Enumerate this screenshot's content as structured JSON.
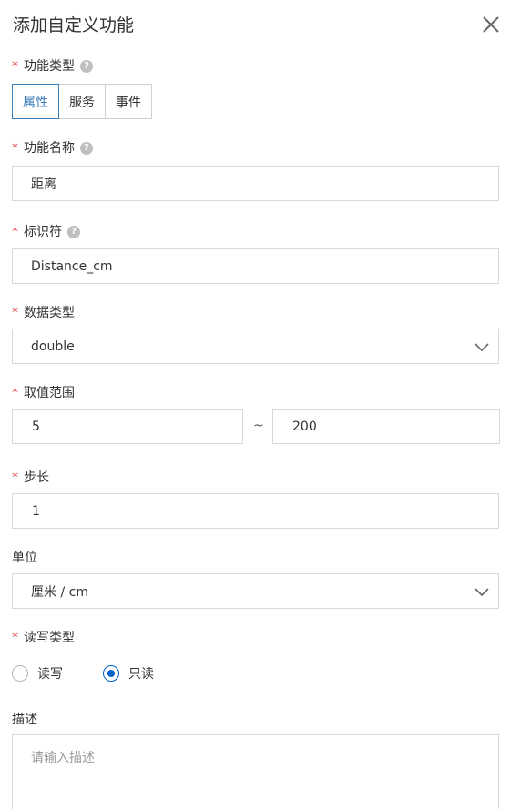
{
  "dialog": {
    "title": "添加自定义功能"
  },
  "required_mark": "*",
  "help_glyph": "?",
  "function_type": {
    "label": "功能类型",
    "options": [
      "属性",
      "服务",
      "事件"
    ],
    "selected": "属性"
  },
  "function_name": {
    "label": "功能名称",
    "value": "距离"
  },
  "identifier": {
    "label": "标识符",
    "value": "Distance_cm"
  },
  "data_type": {
    "label": "数据类型",
    "value": "double"
  },
  "value_range": {
    "label": "取值范围",
    "min": "5",
    "separator": "~",
    "max": "200"
  },
  "step": {
    "label": "步长",
    "value": "1"
  },
  "unit": {
    "label": "单位",
    "value": "厘米 / cm"
  },
  "rw_type": {
    "label": "读写类型",
    "options": [
      "读写",
      "只读"
    ],
    "selected": "只读"
  },
  "description": {
    "label": "描述",
    "placeholder": "请输入描述"
  },
  "colors": {
    "accent": "#0064c8",
    "required": "#e4393c",
    "segment_active": "#3d7fb8"
  },
  "icons": {
    "close": "close-icon",
    "help": "help-icon",
    "caret": "chevron-down-icon"
  }
}
